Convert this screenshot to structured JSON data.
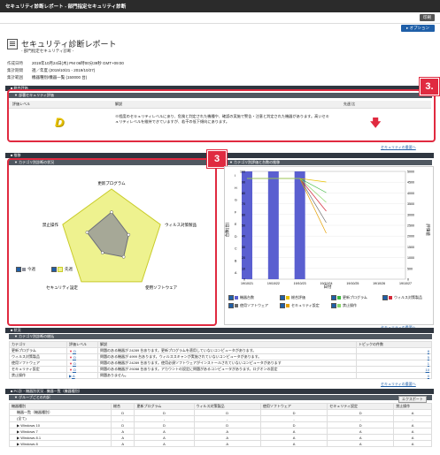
{
  "window_title": "セキュリティ診断レポート - 部門指定セキュリティ診断",
  "toolbar": {
    "print_label": "印刷"
  },
  "options_label": "▸ オプション",
  "header": {
    "title": "セキュリティ診断レポート",
    "subtitle": "- 部門指定セキュリティ診断 -"
  },
  "meta": [
    {
      "label": "作成日時",
      "value": "2019年10月24日(木) PM 06時00分39秒 GMT+09:00"
    },
    {
      "label": "集計期間",
      "value": "週／年度 (2019/10/21 - 2019/10/27)"
    },
    {
      "label": "集計範囲",
      "value": "機器種別/機器一覧 (150000 台)"
    }
  ],
  "section1": {
    "bar": "■ 総合評価",
    "subbar": "▼ 部署セキュリティ評価",
    "col_level": "評価レベル",
    "col_desc": "解説",
    "col_trend": "先週 比",
    "grade": "D",
    "desc": "※程度のセキュリティレベルにあり、危険と判定された機種や、確認の実施で警告・注意と判定された機器があります。高いセキュリティレベルを維持できていますが、若干の低下傾向にあります。",
    "link": "セキュリティの重要へ"
  },
  "badge1": "3.",
  "section2": {
    "bar": "■ 推移",
    "radar_bar": "▼ カテゴリ別診断の状況",
    "trend_bar": "▼ カテゴリ別評価と台数の推移",
    "radar_labels": [
      "更新プログラム",
      "ウィルス対策製品",
      "使用ソフトウェア",
      "セキュリティ設定",
      "禁止操作"
    ],
    "radar_legend": [
      {
        "label": "今週"
      },
      {
        "label": "先週"
      }
    ],
    "y_left_label": "台数(台)",
    "y_right_label": "評価値",
    "x_label": "日付",
    "legend": [
      {
        "label": "機器台数",
        "color": "#5a5fd0"
      },
      {
        "label": "総合評価",
        "color": "#e8c200"
      },
      {
        "label": "更新プログラム",
        "color": "#3fb93f"
      },
      {
        "label": "ウィルス対策製品",
        "color": "#d42a3a"
      },
      {
        "label": "使用ソフトウェア",
        "color": "#6a6a6a"
      },
      {
        "label": "セキュリティ設定",
        "color": "#e6a000"
      },
      {
        "label": "禁止操作",
        "color": "#8ad86a"
      }
    ],
    "link": "セキュリティの重要へ"
  },
  "badge2": "3",
  "chart_data": [
    {
      "type": "radar",
      "categories": [
        "更新プログラム",
        "ウィルス対策製品",
        "使用ソフトウェア",
        "セキュリティ設定",
        "禁止操作"
      ],
      "series": [
        {
          "name": "今週",
          "values": [
            0.55,
            0.35,
            0.4,
            0.3,
            0.5
          ]
        },
        {
          "name": "先週",
          "values": [
            1.0,
            1.0,
            1.0,
            1.0,
            1.0
          ]
        }
      ]
    },
    {
      "type": "bar",
      "categories": [
        "10/21",
        "10/22",
        "10/23",
        "10/24",
        "10/25",
        "10/26",
        "10/27"
      ],
      "x": [
        "19/10/21",
        "19/10/22",
        "19/10/23",
        "19/10/24",
        "19/10/25",
        "19/10/26",
        "19/10/27"
      ],
      "y_left_ticks": [
        0,
        10,
        20,
        30,
        40,
        50,
        60,
        70,
        80,
        90,
        100
      ],
      "y_right_ticks": [
        0,
        500,
        1000,
        1500,
        2000,
        2500,
        3000,
        3500,
        4000,
        4500,
        5000
      ],
      "y_grade_ticks": [
        "A",
        "B",
        "C",
        "D",
        "E",
        "F",
        "G",
        "H",
        "I"
      ],
      "series": [
        {
          "name": "機器台数",
          "values": [
            100,
            100,
            100,
            null,
            null,
            null,
            null
          ]
        }
      ]
    }
  ],
  "section3": {
    "bar": "■ 状況",
    "subbar": "▼ カテゴリ別診断の総括",
    "cols": [
      "カテゴリ",
      "評価レベル",
      "解説",
      "トピックの件数"
    ],
    "rows": [
      {
        "cat": "更新プログラム",
        "grade": "D",
        "arrow": "▼",
        "desc": "問題のある機器が 24289 台あります。更新プログラムを適用していないコンピュータがあります。",
        "count": "8"
      },
      {
        "cat": "ウィルス対策製品",
        "grade": "D",
        "arrow": "▼",
        "desc": "問題のある機器が 4999 台あります。ウィルススキャンが実施されていないコンピュータがあります。",
        "count": "5"
      },
      {
        "cat": "使用ソフトウェア",
        "grade": "D",
        "arrow": "▼",
        "desc": "問題のある機器が 24289 台あります。使用必須ソフトウェアがインストールされていないコンピュータがあります",
        "count": "1"
      },
      {
        "cat": "セキュリティ設定",
        "grade": "D",
        "arrow": "▼",
        "desc": "問題のある機器が 29288 台あります。アカウントの設定に問題があるコンピュータがあります。ログオンの設定",
        "count": "10"
      },
      {
        "cat": "禁止操作",
        "grade": "A",
        "arrow": "▶",
        "desc": "問題ありません。",
        "count": "0"
      }
    ],
    "link": "セキュリティの重要へ"
  },
  "section4": {
    "bar": "■ PC計・機器別状況 - 機器一覧（機器種別）",
    "subbar": "▼ グループごとの内訳",
    "export": "エクスポート",
    "cols": [
      "機器種別",
      "総合",
      "更新プログラム",
      "ウィルス対策製品",
      "使用ソフトウェア",
      "セキュリティ設定",
      "禁止操作"
    ],
    "rows": [
      {
        "name": "機器一覧（機器種別）",
        "vals": [
          "D",
          "D",
          "D",
          "D",
          "D",
          "A"
        ]
      },
      {
        "name": "(全て)",
        "vals": [
          "-",
          "-",
          "-",
          "-",
          "-",
          "-"
        ]
      },
      {
        "name": "▶ Windows 10",
        "vals": [
          "D",
          "D",
          "D",
          "D",
          "D",
          "A"
        ]
      },
      {
        "name": "▶ Windows 7",
        "vals": [
          "A",
          "A",
          "A",
          "A",
          "A",
          "A"
        ]
      },
      {
        "name": "▶ Windows 8.1",
        "vals": [
          "A",
          "A",
          "A",
          "A",
          "A",
          "A"
        ]
      },
      {
        "name": "▶ Windows 8",
        "vals": [
          "A",
          "A",
          "A",
          "A",
          "A",
          "A"
        ]
      }
    ]
  }
}
